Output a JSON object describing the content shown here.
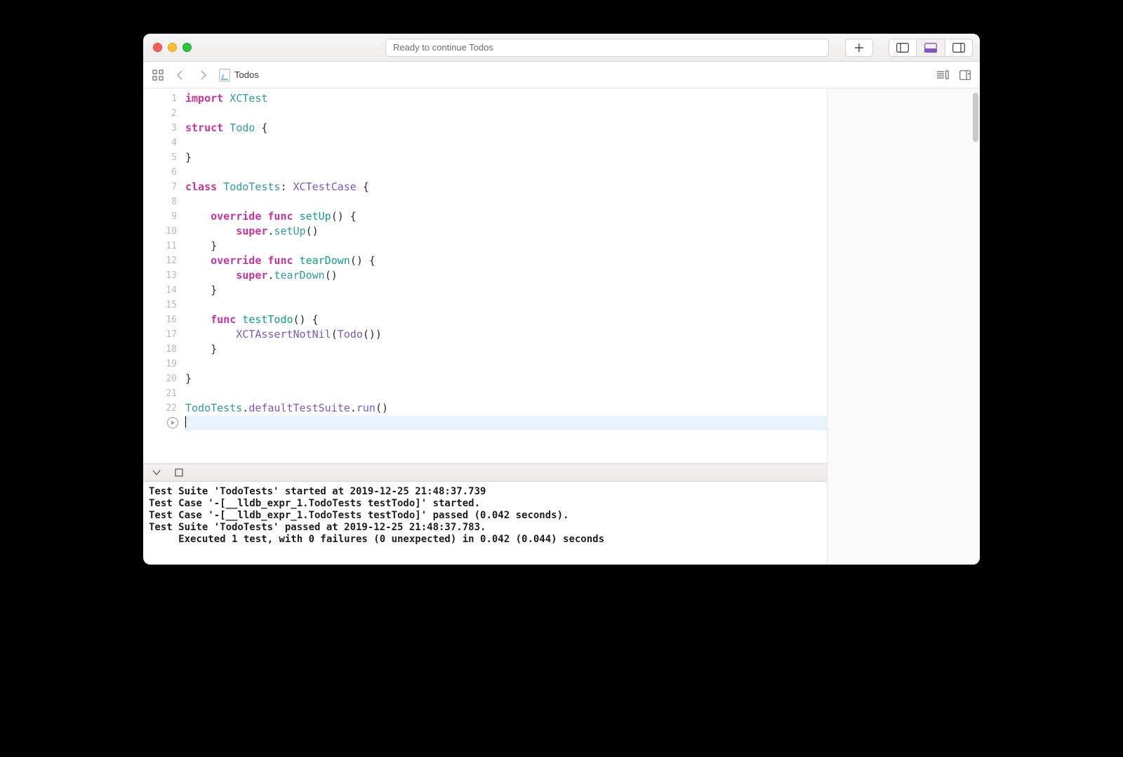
{
  "titlebar": {
    "status_text": "Ready to continue Todos"
  },
  "navbar": {
    "file_name": "Todos"
  },
  "code": {
    "lines": [
      [
        [
          "kw-pink",
          "import"
        ],
        [
          "",
          " "
        ],
        [
          "type",
          "XCTest"
        ]
      ],
      [],
      [
        [
          "kw-pink",
          "struct"
        ],
        [
          "",
          " "
        ],
        [
          "type",
          "Todo"
        ],
        [
          "",
          " {"
        ]
      ],
      [],
      [
        [
          "",
          "}"
        ]
      ],
      [],
      [
        [
          "kw-pink",
          "class"
        ],
        [
          "",
          " "
        ],
        [
          "type",
          "TodoTests"
        ],
        [
          "",
          ": "
        ],
        [
          "call",
          "XCTestCase"
        ],
        [
          "",
          " {"
        ]
      ],
      [],
      [
        [
          "",
          "    "
        ],
        [
          "kw-pink",
          "override"
        ],
        [
          "",
          " "
        ],
        [
          "kw-pink",
          "func"
        ],
        [
          "",
          " "
        ],
        [
          "fn",
          "setUp"
        ],
        [
          "",
          "() {"
        ]
      ],
      [
        [
          "",
          "        "
        ],
        [
          "kw-pink",
          "super"
        ],
        [
          "dot",
          "."
        ],
        [
          "member",
          "setUp"
        ],
        [
          "",
          "()"
        ]
      ],
      [
        [
          "",
          "    }"
        ]
      ],
      [
        [
          "",
          "    "
        ],
        [
          "kw-pink",
          "override"
        ],
        [
          "",
          " "
        ],
        [
          "kw-pink",
          "func"
        ],
        [
          "",
          " "
        ],
        [
          "fn",
          "tearDown"
        ],
        [
          "",
          "() {"
        ]
      ],
      [
        [
          "",
          "        "
        ],
        [
          "kw-pink",
          "super"
        ],
        [
          "dot",
          "."
        ],
        [
          "member",
          "tearDown"
        ],
        [
          "",
          "()"
        ]
      ],
      [
        [
          "",
          "    }"
        ]
      ],
      [],
      [
        [
          "",
          "    "
        ],
        [
          "kw-pink",
          "func"
        ],
        [
          "",
          " "
        ],
        [
          "fn",
          "testTodo"
        ],
        [
          "",
          "() {"
        ]
      ],
      [
        [
          "",
          "        "
        ],
        [
          "call",
          "XCTAssertNotNil"
        ],
        [
          "",
          "("
        ],
        [
          "call",
          "Todo"
        ],
        [
          "",
          "())"
        ]
      ],
      [
        [
          "",
          "    }"
        ]
      ],
      [],
      [
        [
          "",
          "}"
        ]
      ],
      [],
      [
        [
          "type",
          "TodoTests"
        ],
        [
          "dot",
          "."
        ],
        [
          "call",
          "defaultTestSuite"
        ],
        [
          "dot",
          "."
        ],
        [
          "call",
          "run"
        ],
        [
          "",
          "()"
        ]
      ]
    ],
    "current_line_index": 22
  },
  "console": {
    "lines": [
      "Test Suite 'TodoTests' started at 2019-12-25 21:48:37.739",
      "Test Case '-[__lldb_expr_1.TodoTests testTodo]' started.",
      "Test Case '-[__lldb_expr_1.TodoTests testTodo]' passed (0.042 seconds).",
      "Test Suite 'TodoTests' passed at 2019-12-25 21:48:37.783.",
      "     Executed 1 test, with 0 failures (0 unexpected) in 0.042 (0.044) seconds"
    ]
  }
}
